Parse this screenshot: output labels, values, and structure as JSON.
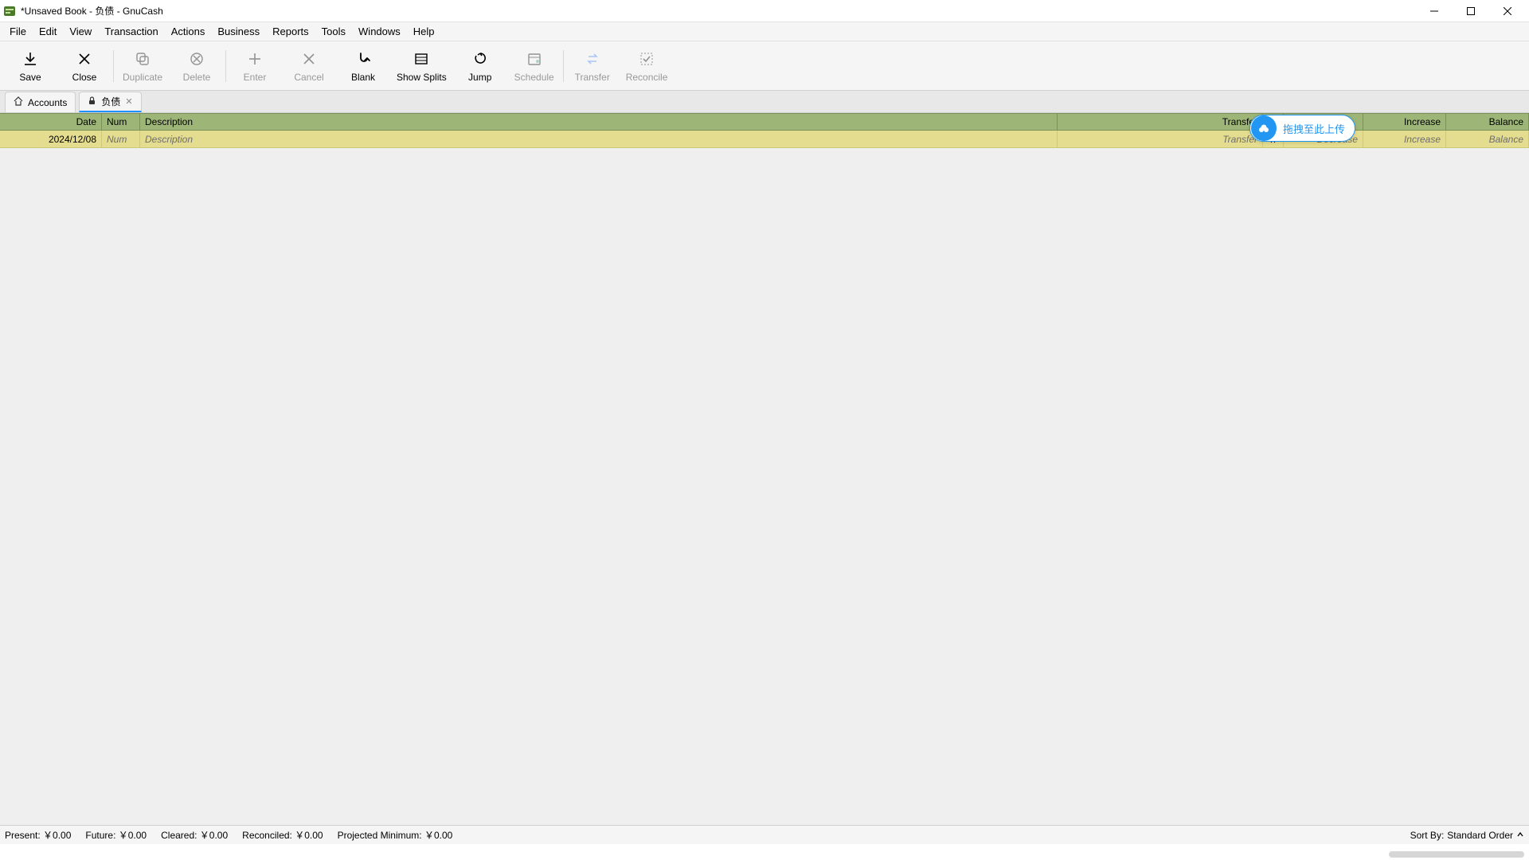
{
  "window": {
    "title": "*Unsaved Book - 负债 - GnuCash"
  },
  "menu": {
    "items": [
      "File",
      "Edit",
      "View",
      "Transaction",
      "Actions",
      "Business",
      "Reports",
      "Tools",
      "Windows",
      "Help"
    ]
  },
  "toolbar": {
    "save": "Save",
    "close": "Close",
    "duplicate": "Duplicate",
    "delete": "Delete",
    "enter": "Enter",
    "cancel": "Cancel",
    "blank": "Blank",
    "show_splits": "Show Splits",
    "jump": "Jump",
    "schedule": "Schedule",
    "transfer": "Transfer",
    "reconcile": "Reconcile"
  },
  "tabs": {
    "accounts": "Accounts",
    "ledger": "负债"
  },
  "columns": {
    "date": "Date",
    "num": "Num",
    "description": "Description",
    "transfer": "Transfer",
    "increase": "Increase",
    "balance": "Balance"
  },
  "row": {
    "date": "2024/12/08",
    "num_ph": "Num",
    "desc_ph": "Description",
    "transfer_ph": "Transfer",
    "r": "n",
    "decrease_ph": "Decrease",
    "increase_ph": "Increase",
    "balance_ph": "Balance"
  },
  "upload": {
    "text": "拖拽至此上传"
  },
  "status": {
    "present": "Present: ￥0.00",
    "future": "Future: ￥0.00",
    "cleared": "Cleared: ￥0.00",
    "reconciled": "Reconciled: ￥0.00",
    "projected": "Projected Minimum: ￥0.00",
    "sort_label": "Sort By:",
    "sort_value": "Standard Order"
  }
}
